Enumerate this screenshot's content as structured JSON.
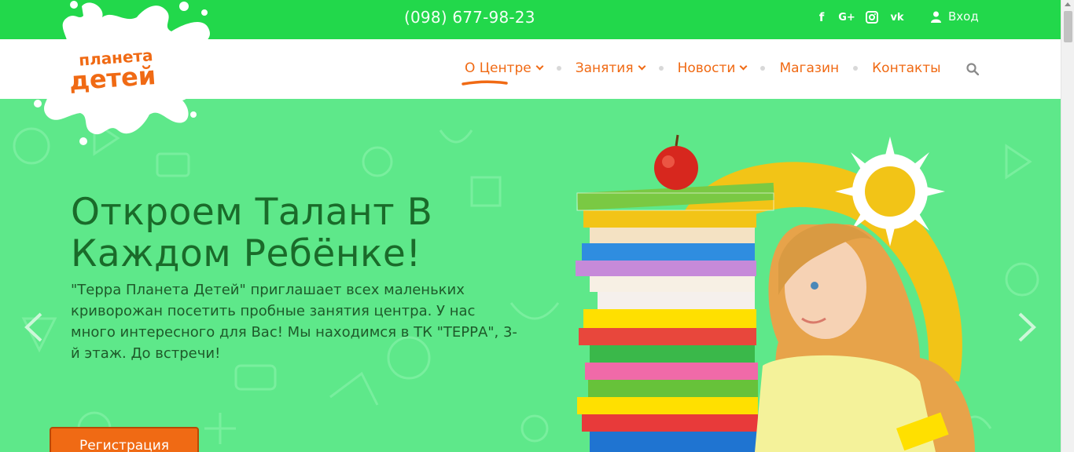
{
  "topbar": {
    "phone": "(098) 677-98-23",
    "socials": [
      {
        "icon": "facebook-icon",
        "glyph": "f"
      },
      {
        "icon": "google-plus-icon",
        "glyph": "G+"
      },
      {
        "icon": "instagram-icon",
        "glyph": ""
      },
      {
        "icon": "vk-icon",
        "glyph": "vk"
      }
    ],
    "login_label": "Вход"
  },
  "logo": {
    "line1": "планета",
    "line2": "детей"
  },
  "nav": {
    "items": [
      {
        "label": "О Центре",
        "has_dropdown": true,
        "active": true
      },
      {
        "label": "Занятия",
        "has_dropdown": true
      },
      {
        "label": "Новости",
        "has_dropdown": true
      },
      {
        "label": "Магазин",
        "has_dropdown": false
      },
      {
        "label": "Контакты",
        "has_dropdown": false
      }
    ]
  },
  "hero": {
    "headline": "Откроем Талант В Каждом Ребёнке!",
    "description": "\"Терра Планета Детей\" приглашает всех маленьких криворожан посетить пробные занятия центра. У нас много интересного для Вас! Мы находимся в ТК \"ТЕРРА\", 3-й этаж. До встречи!",
    "cta_label": "Регистрация"
  },
  "colors": {
    "topbar": "#22d84b",
    "accent": "#f06a14",
    "hero_bg": "#5ee88a",
    "headline": "#1a6b2a"
  }
}
